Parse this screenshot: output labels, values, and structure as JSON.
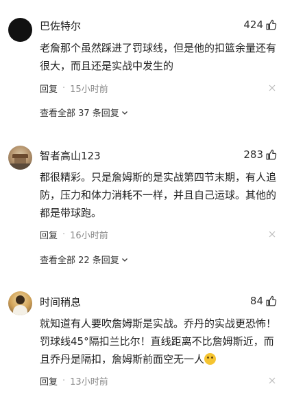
{
  "comments": [
    {
      "username": "巴佐特尔",
      "likes": "424",
      "text": "老詹那个虽然踩进了罚球线，但是他的扣篮余量还有很大，而且还是实战中发生的",
      "reply_label": "回复",
      "separator": "·",
      "time": "15小时前",
      "view_all": "查看全部 37 条回复"
    },
    {
      "username": "智者高山123",
      "likes": "283",
      "text": "都很精彩。只是詹姆斯的是实战第四节末期，有人追防，压力和体力消耗不一样，并且自己运球。其他的都是带球跑。",
      "reply_label": "回复",
      "separator": "·",
      "time": "16小时前",
      "view_all": "查看全部 22 条回复"
    },
    {
      "username": "时间稍息",
      "likes": "84",
      "text": "就知道有人要吹詹姆斯是实战。乔丹的实战更恐怖！罚球线45°隔扣兰比尔！直线距离不比詹姆斯近，而且乔丹是隔扣，詹姆斯前面空无一人",
      "emoji": "thinking-face",
      "reply_label": "回复",
      "separator": "·",
      "time": "13小时前"
    }
  ],
  "colors": {
    "text": "#222222",
    "meta": "#888888",
    "background": "#ffffff"
  },
  "icons": {
    "like": "thumbs-up-icon",
    "dismiss": "close-icon",
    "expand": "chevron-down-icon"
  }
}
